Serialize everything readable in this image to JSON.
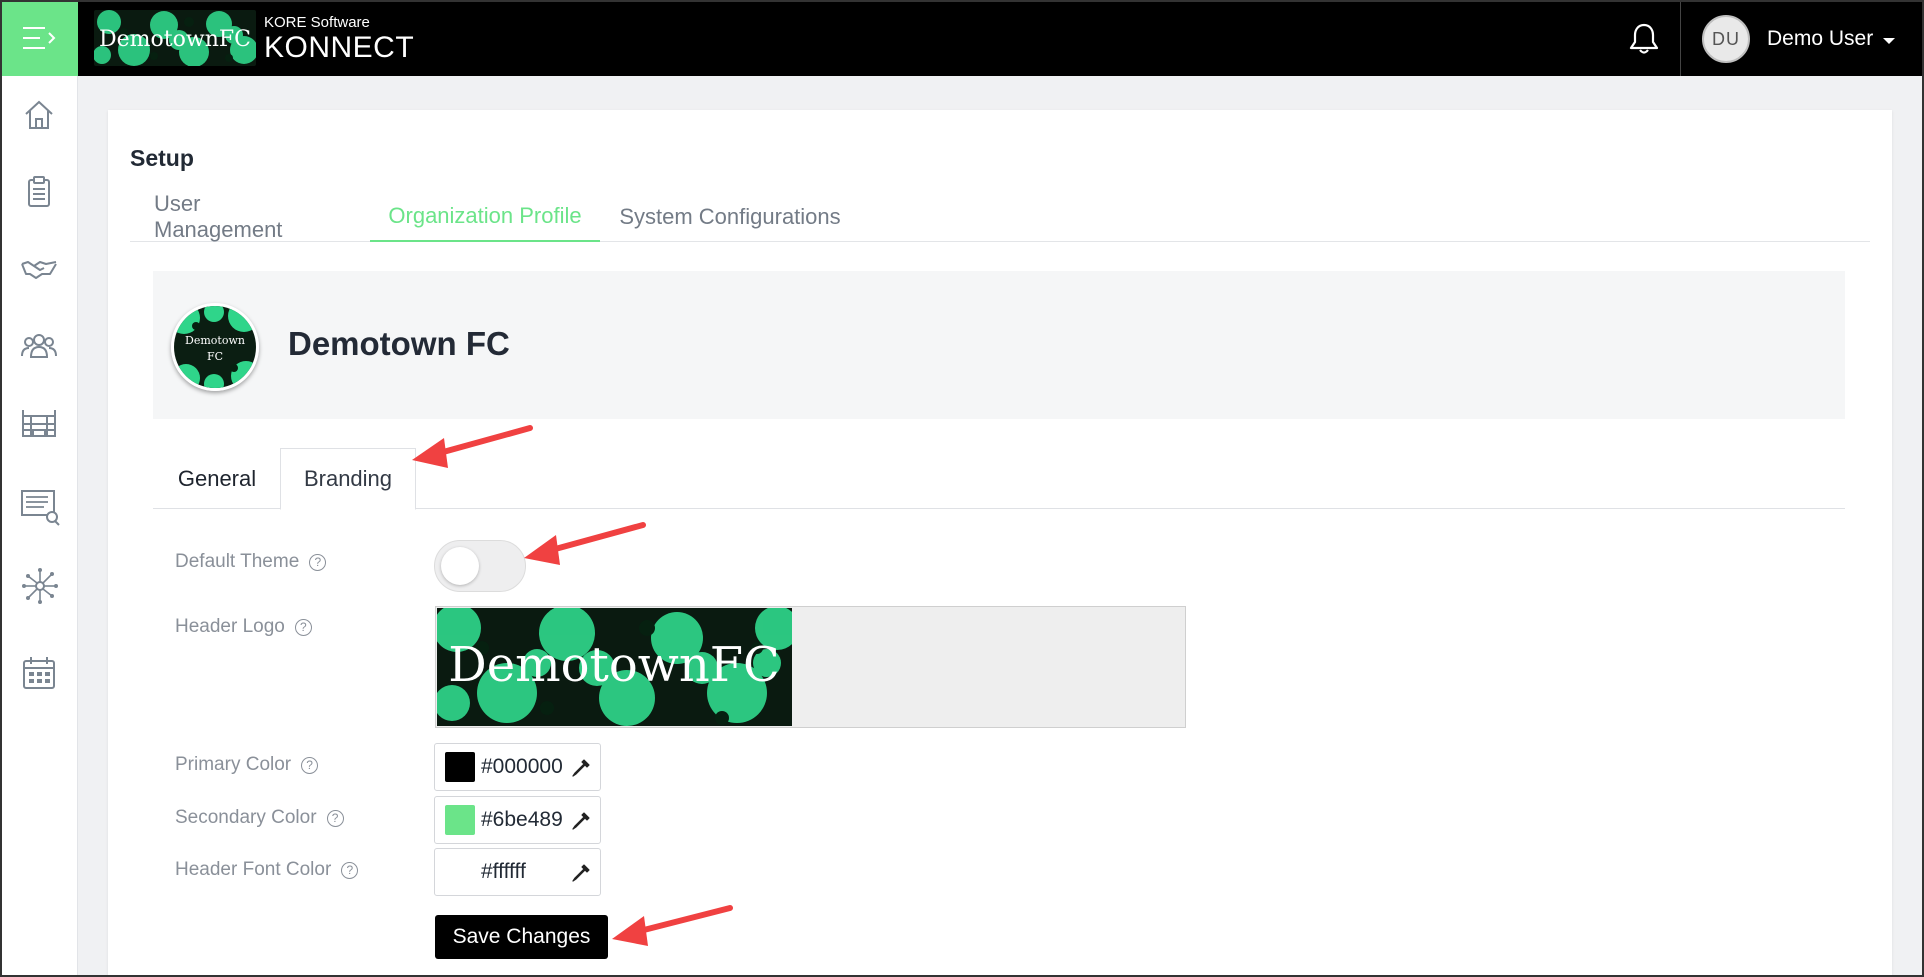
{
  "header": {
    "menu_icon": "menu-toggle-icon",
    "logo_text": "DemotownFC",
    "brand_small": "KORE Software",
    "brand_big": "KONNECT",
    "notification_icon": "bell-icon",
    "user": {
      "initials": "DU",
      "name": "Demo User"
    }
  },
  "sidebar": {
    "items": [
      {
        "icon": "home-icon"
      },
      {
        "icon": "clipboard-icon"
      },
      {
        "icon": "handshake-icon"
      },
      {
        "icon": "people-group-icon"
      },
      {
        "icon": "stadium-icon"
      },
      {
        "icon": "report-search-icon"
      },
      {
        "icon": "network-icon"
      },
      {
        "icon": "calendar-icon"
      }
    ]
  },
  "page": {
    "title": "Setup",
    "tabs": [
      {
        "label": "User Management",
        "active": false
      },
      {
        "label": "Organization Profile",
        "active": true
      },
      {
        "label": "System Configurations",
        "active": false
      }
    ]
  },
  "org": {
    "name": "Demotown FC",
    "avatar_text_line1": "Demotown",
    "avatar_text_line2": "FC"
  },
  "sub_tabs": [
    {
      "label": "General",
      "active": false
    },
    {
      "label": "Branding",
      "active": true
    }
  ],
  "branding": {
    "default_theme_label": "Default Theme",
    "default_theme_on": false,
    "header_logo_label": "Header Logo",
    "header_logo_text": "DemotownFC",
    "primary_color_label": "Primary Color",
    "primary_color": "#000000",
    "secondary_color_label": "Secondary Color",
    "secondary_color": "#6be489",
    "header_font_color_label": "Header Font Color",
    "header_font_color": "#ffffff",
    "help_glyph": "?",
    "save_label": "Save Changes"
  },
  "colors": {
    "accent": "#6be489",
    "annotation_arrow": "#f04141"
  }
}
